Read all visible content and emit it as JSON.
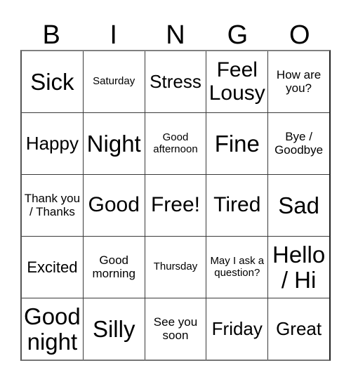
{
  "card": {
    "header_letters": [
      "B",
      "I",
      "N",
      "G",
      "O"
    ],
    "rows": [
      [
        {
          "text": "Sick",
          "size": "fs-xl"
        },
        {
          "text": "Saturday",
          "size": "fs-xxs"
        },
        {
          "text": "Stress",
          "size": "fs-md"
        },
        {
          "text": "Feel Lousy",
          "size": "fs-lg"
        },
        {
          "text": "How are you?",
          "size": "fs-xs"
        }
      ],
      [
        {
          "text": "Happy",
          "size": "fs-md"
        },
        {
          "text": "Night",
          "size": "fs-xl"
        },
        {
          "text": "Good afternoon",
          "size": "fs-xxs"
        },
        {
          "text": "Fine",
          "size": "fs-xl"
        },
        {
          "text": "Bye / Goodbye",
          "size": "fs-xs"
        }
      ],
      [
        {
          "text": "Thank you / Thanks",
          "size": "fs-xs"
        },
        {
          "text": "Good",
          "size": "fs-lg"
        },
        {
          "text": "Free!",
          "size": "fs-lg"
        },
        {
          "text": "Tired",
          "size": "fs-lg"
        },
        {
          "text": "Sad",
          "size": "fs-xl"
        }
      ],
      [
        {
          "text": "Excited",
          "size": "fs-sm"
        },
        {
          "text": "Good morning",
          "size": "fs-xs"
        },
        {
          "text": "Thursday",
          "size": "fs-xxs"
        },
        {
          "text": "May I ask a question?",
          "size": "fs-xxs"
        },
        {
          "text": "Hello / Hi",
          "size": "fs-xl"
        }
      ],
      [
        {
          "text": "Good night",
          "size": "fs-xl"
        },
        {
          "text": "Silly",
          "size": "fs-xl"
        },
        {
          "text": "See you soon",
          "size": "fs-xs"
        },
        {
          "text": "Friday",
          "size": "fs-md"
        },
        {
          "text": "Great",
          "size": "fs-md"
        }
      ]
    ]
  },
  "colors": {
    "background": "#ffffff",
    "text": "#000000",
    "grid_line": "#3a3a3a",
    "grid_outer": "#555555"
  }
}
